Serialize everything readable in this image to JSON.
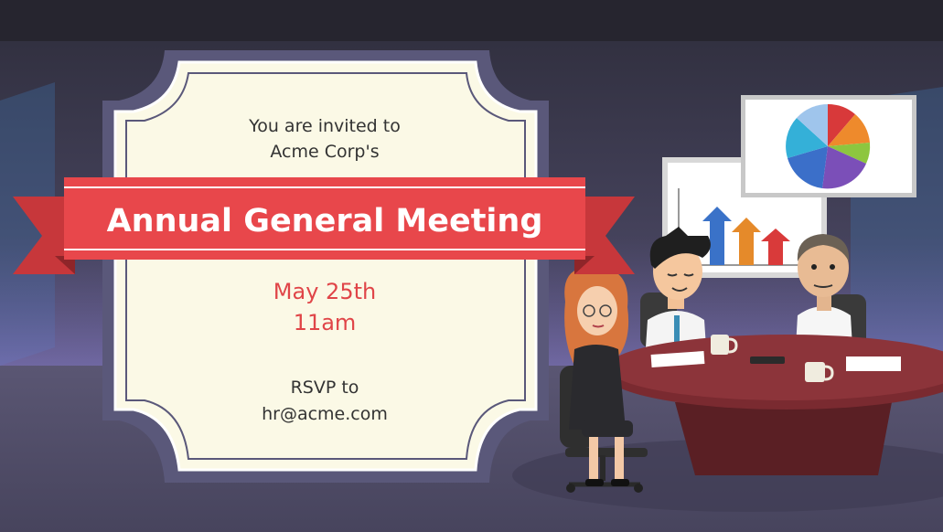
{
  "invitation": {
    "intro_line1": "You are invited to",
    "intro_line2": "Acme Corp's",
    "title": "Annual General Meeting",
    "date": "May 25th",
    "time": "11am",
    "rsvp_line1": "RSVP to",
    "rsvp_line2": "hr@acme.com"
  },
  "colors": {
    "banner": "#e8474b",
    "card": "#fbf9e6",
    "frame": "#5a587a",
    "accent_text": "#e04548"
  }
}
